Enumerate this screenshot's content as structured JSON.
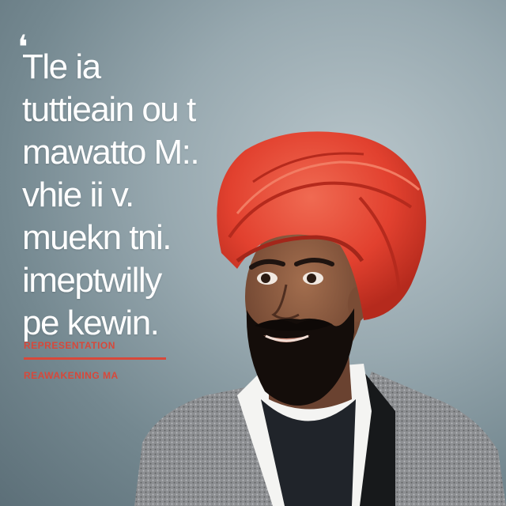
{
  "headline": {
    "lines": [
      "Tle ia",
      "tuttieain ou t",
      "mawatto M:.",
      "vhie ii v.",
      "muekn tni.",
      "imeptwilly",
      "pe kewin."
    ]
  },
  "captions": {
    "first": "REPRESENTATION",
    "second": "REAWAKENING MA"
  },
  "colors": {
    "background": "#98a9b0",
    "headline_text": "#ffffff",
    "accent_red": "#d8483a",
    "turban": "#e2412f"
  }
}
